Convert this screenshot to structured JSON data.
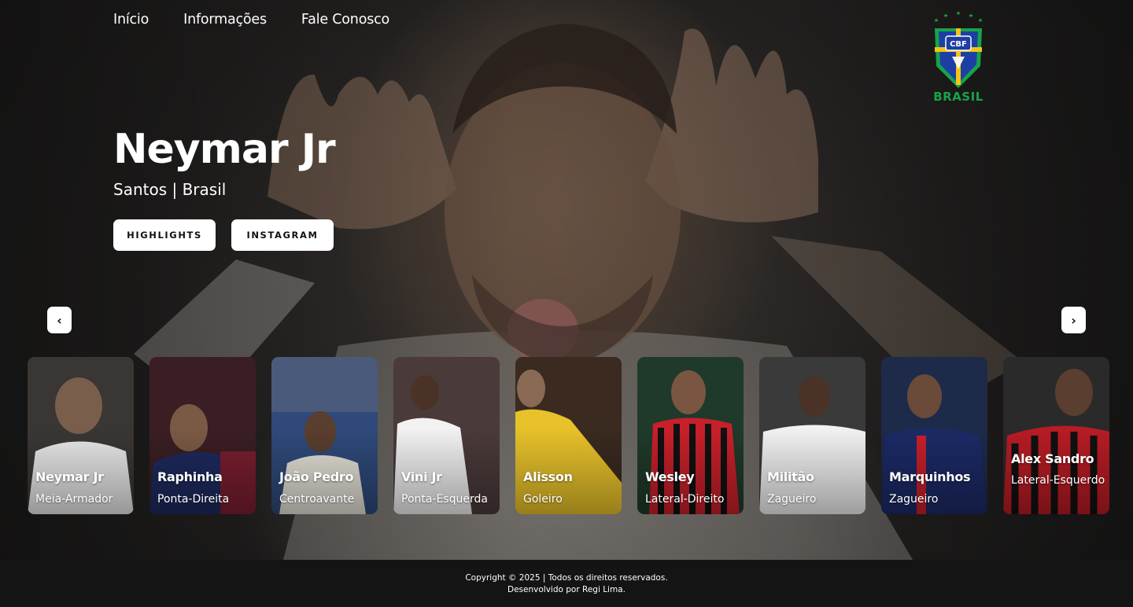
{
  "nav": {
    "items": [
      {
        "label": "Início"
      },
      {
        "label": "Informações"
      },
      {
        "label": "Fale Conosco"
      }
    ]
  },
  "logo": {
    "badge_text": "CBF",
    "label": "BRASIL",
    "colors": {
      "green": "#17a34a",
      "blue": "#1d3fa3",
      "yellow": "#f2c318"
    }
  },
  "hero": {
    "name": "Neymar Jr",
    "subtitle": "Santos | Brasil",
    "buttons": {
      "highlights": "HIGHLIGHTS",
      "instagram": "INSTAGRAM"
    }
  },
  "carousel": {
    "prev_icon": "chevron-left-icon",
    "next_icon": "chevron-right-icon",
    "prev_glyph": "‹",
    "next_glyph": "›",
    "players": [
      {
        "name": "Neymar Jr",
        "position": "Meia-Armador",
        "kit": "#e8e8e8",
        "bg": "#3a3633"
      },
      {
        "name": "Raphinha",
        "position": "Ponta-Direita",
        "kit": "#1e2a5e",
        "bg": "#3a1e24"
      },
      {
        "name": "João Pedro",
        "position": "Centroavante",
        "kit": "#e6e2d8",
        "bg": "#2f4a7a"
      },
      {
        "name": "Vini Jr",
        "position": "Ponta-Esquerda",
        "kit": "#f2f2f2",
        "bg": "#4b3a3a"
      },
      {
        "name": "Alisson",
        "position": "Goleiro",
        "kit": "#e8c22a",
        "bg": "#3a2a20"
      },
      {
        "name": "Wesley",
        "position": "Lateral-Direito",
        "kit": "#c8202a",
        "bg": "#1f3a2a"
      },
      {
        "name": "Militão",
        "position": "Zagueiro",
        "kit": "#f2f2f2",
        "bg": "#3a3a3a"
      },
      {
        "name": "Marquinhos",
        "position": "Zagueiro",
        "kit": "#1c2a66",
        "bg": "#1e2a4a"
      },
      {
        "name": "Alex Sandro",
        "position": "Lateral-Esquerdo",
        "kit": "#b81c24",
        "bg": "#2a2a2a"
      }
    ]
  },
  "footer": {
    "line1": "Copyright © 2025 | Todos os direitos reservados.",
    "line2": "Desenvolvido por Regi Lima."
  }
}
